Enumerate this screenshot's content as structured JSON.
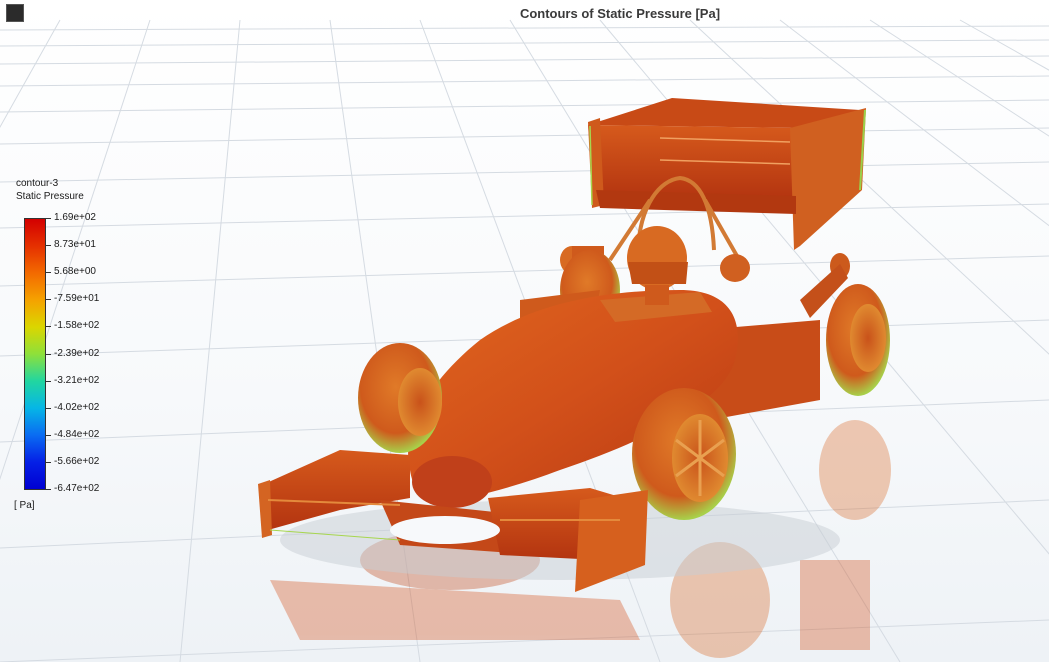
{
  "window": {
    "title": "Contours of Static Pressure [Pa]",
    "logo_icon": "ansys-logo-icon"
  },
  "legend": {
    "name": "contour-3",
    "variable": "Static Pressure",
    "unit": "[ Pa]",
    "colormap": [
      "#d30000",
      "#e53000",
      "#f36a00",
      "#f5a200",
      "#dbd600",
      "#8ee03a",
      "#22d6a0",
      "#06b6e6",
      "#0a6cf2",
      "#0520e6",
      "#0000d2"
    ],
    "ticks": [
      "1.69e+02",
      "8.73e+01",
      "5.68e+00",
      "-7.59e+01",
      "-1.58e+02",
      "-2.39e+02",
      "-3.21e+02",
      "-4.02e+02",
      "-4.84e+02",
      "-5.66e+02",
      "-6.47e+02"
    ]
  },
  "scene": {
    "object": "formula-student-race-car",
    "ground_grid": "on",
    "reflection": "on",
    "dominant_color": "#d4501a"
  }
}
